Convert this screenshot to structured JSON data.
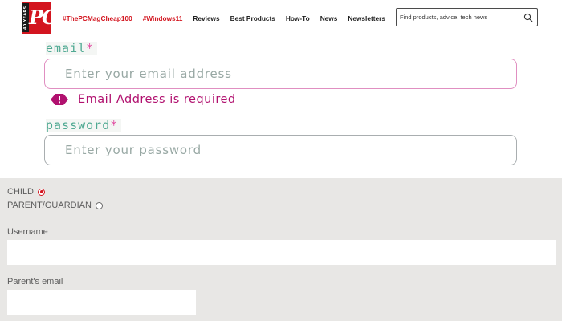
{
  "header": {
    "logo": {
      "text": "PC",
      "side_text": "40 YEARS",
      "color": "#d3151f"
    },
    "nav": [
      {
        "label": "#ThePCMagCheap100",
        "kind": "hashtag"
      },
      {
        "label": "#Windows11",
        "kind": "hashtag"
      },
      {
        "label": "Reviews",
        "kind": "link"
      },
      {
        "label": "Best Products",
        "kind": "link"
      },
      {
        "label": "How-To",
        "kind": "link"
      },
      {
        "label": "News",
        "kind": "link"
      },
      {
        "label": "Newsletters",
        "kind": "link"
      }
    ],
    "search": {
      "placeholder": "Find products, advice, tech news",
      "icon": "search-icon"
    }
  },
  "login": {
    "email": {
      "label": "email",
      "required_mark": "*",
      "placeholder": "Enter your email address",
      "error": "Email Address is required",
      "error_icon": "alert-icon",
      "error_color": "#b1116f"
    },
    "password": {
      "label": "password",
      "required_mark": "*",
      "placeholder": "Enter your password"
    },
    "label_color": "#4fa992",
    "required_color": "#e0489f"
  },
  "register": {
    "role_options": [
      {
        "label": "CHILD",
        "selected": true
      },
      {
        "label": "PARENT/GUARDIAN",
        "selected": false
      }
    ],
    "username": {
      "label": "Username",
      "value": ""
    },
    "parent_email": {
      "label": "Parent's email",
      "value": ""
    }
  }
}
